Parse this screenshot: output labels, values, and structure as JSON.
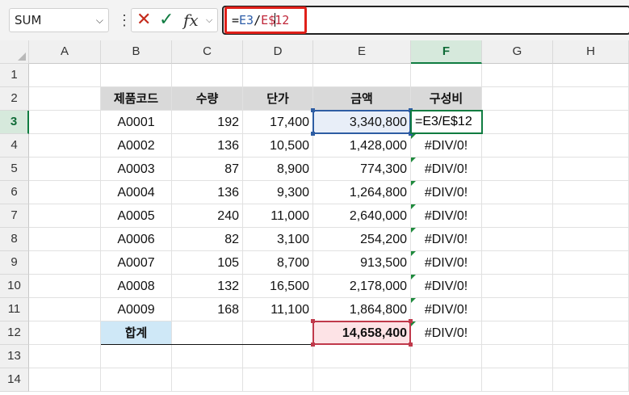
{
  "name_box": "SUM",
  "formula_bar": {
    "prefix": "=",
    "ref1": "E3",
    "sep": "/",
    "ref2a": "E$",
    "ref2b": "12",
    "cancel_icon": "✕",
    "enter_icon": "✓",
    "fx_label": "fx"
  },
  "columns": [
    "A",
    "B",
    "C",
    "D",
    "E",
    "F",
    "G",
    "H"
  ],
  "active_column": "F",
  "rows": [
    "1",
    "2",
    "3",
    "4",
    "5",
    "6",
    "7",
    "8",
    "9",
    "10",
    "11",
    "12",
    "13",
    "14"
  ],
  "active_row": "3",
  "headers": [
    "제품코드",
    "수량",
    "단가",
    "금액",
    "구성비"
  ],
  "data_rows": [
    {
      "code": "A0001",
      "qty": "192",
      "price": "17,400",
      "amount": "3,340,800",
      "ratio": "=E3/E$12"
    },
    {
      "code": "A0002",
      "qty": "136",
      "price": "10,500",
      "amount": "1,428,000",
      "ratio": "#DIV/0!"
    },
    {
      "code": "A0003",
      "qty": "87",
      "price": "8,900",
      "amount": "774,300",
      "ratio": "#DIV/0!"
    },
    {
      "code": "A0004",
      "qty": "136",
      "price": "9,300",
      "amount": "1,264,800",
      "ratio": "#DIV/0!"
    },
    {
      "code": "A0005",
      "qty": "240",
      "price": "11,000",
      "amount": "2,640,000",
      "ratio": "#DIV/0!"
    },
    {
      "code": "A0006",
      "qty": "82",
      "price": "3,100",
      "amount": "254,200",
      "ratio": "#DIV/0!"
    },
    {
      "code": "A0007",
      "qty": "105",
      "price": "8,700",
      "amount": "913,500",
      "ratio": "#DIV/0!"
    },
    {
      "code": "A0008",
      "qty": "132",
      "price": "16,500",
      "amount": "2,178,000",
      "ratio": "#DIV/0!"
    },
    {
      "code": "A0009",
      "qty": "168",
      "price": "11,100",
      "amount": "1,864,800",
      "ratio": "#DIV/0!"
    }
  ],
  "total": {
    "label": "합계",
    "amount": "14,658,400",
    "ratio": "#DIV/0!"
  },
  "colors": {
    "accent_green": "#107c41",
    "ref_blue": "#2e5da3",
    "ref_red": "#c0394b",
    "highlight_red": "#e0201a"
  }
}
